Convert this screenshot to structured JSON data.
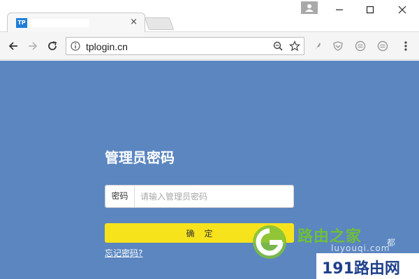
{
  "browser": {
    "tab": {
      "favicon_text": "TP",
      "title": "",
      "close_glyph": "×"
    },
    "window_controls": [
      "minimize-icon",
      "maximize-icon",
      "close-icon"
    ],
    "toolbar": {
      "back": "back-arrow-icon",
      "forward": "forward-arrow-icon",
      "reload": "reload-icon",
      "url": "tplogin.cn",
      "extensions": [
        "feather-icon",
        "shield-icon",
        "ext-icon-1",
        "ext-icon-2",
        "menu-icon"
      ]
    }
  },
  "page": {
    "background_color": "#5b86c0",
    "title": "管理员密码",
    "password_field": {
      "label": "密码",
      "placeholder": "请输入管理员密码",
      "value": ""
    },
    "confirm_button": {
      "label": "确定",
      "color": "#f7e31b"
    },
    "forgot_link": "忘记密码?"
  },
  "watermarks": {
    "brand": "路由之家",
    "url": "luyouqi.com",
    "du": "都",
    "site": "191路由网"
  }
}
